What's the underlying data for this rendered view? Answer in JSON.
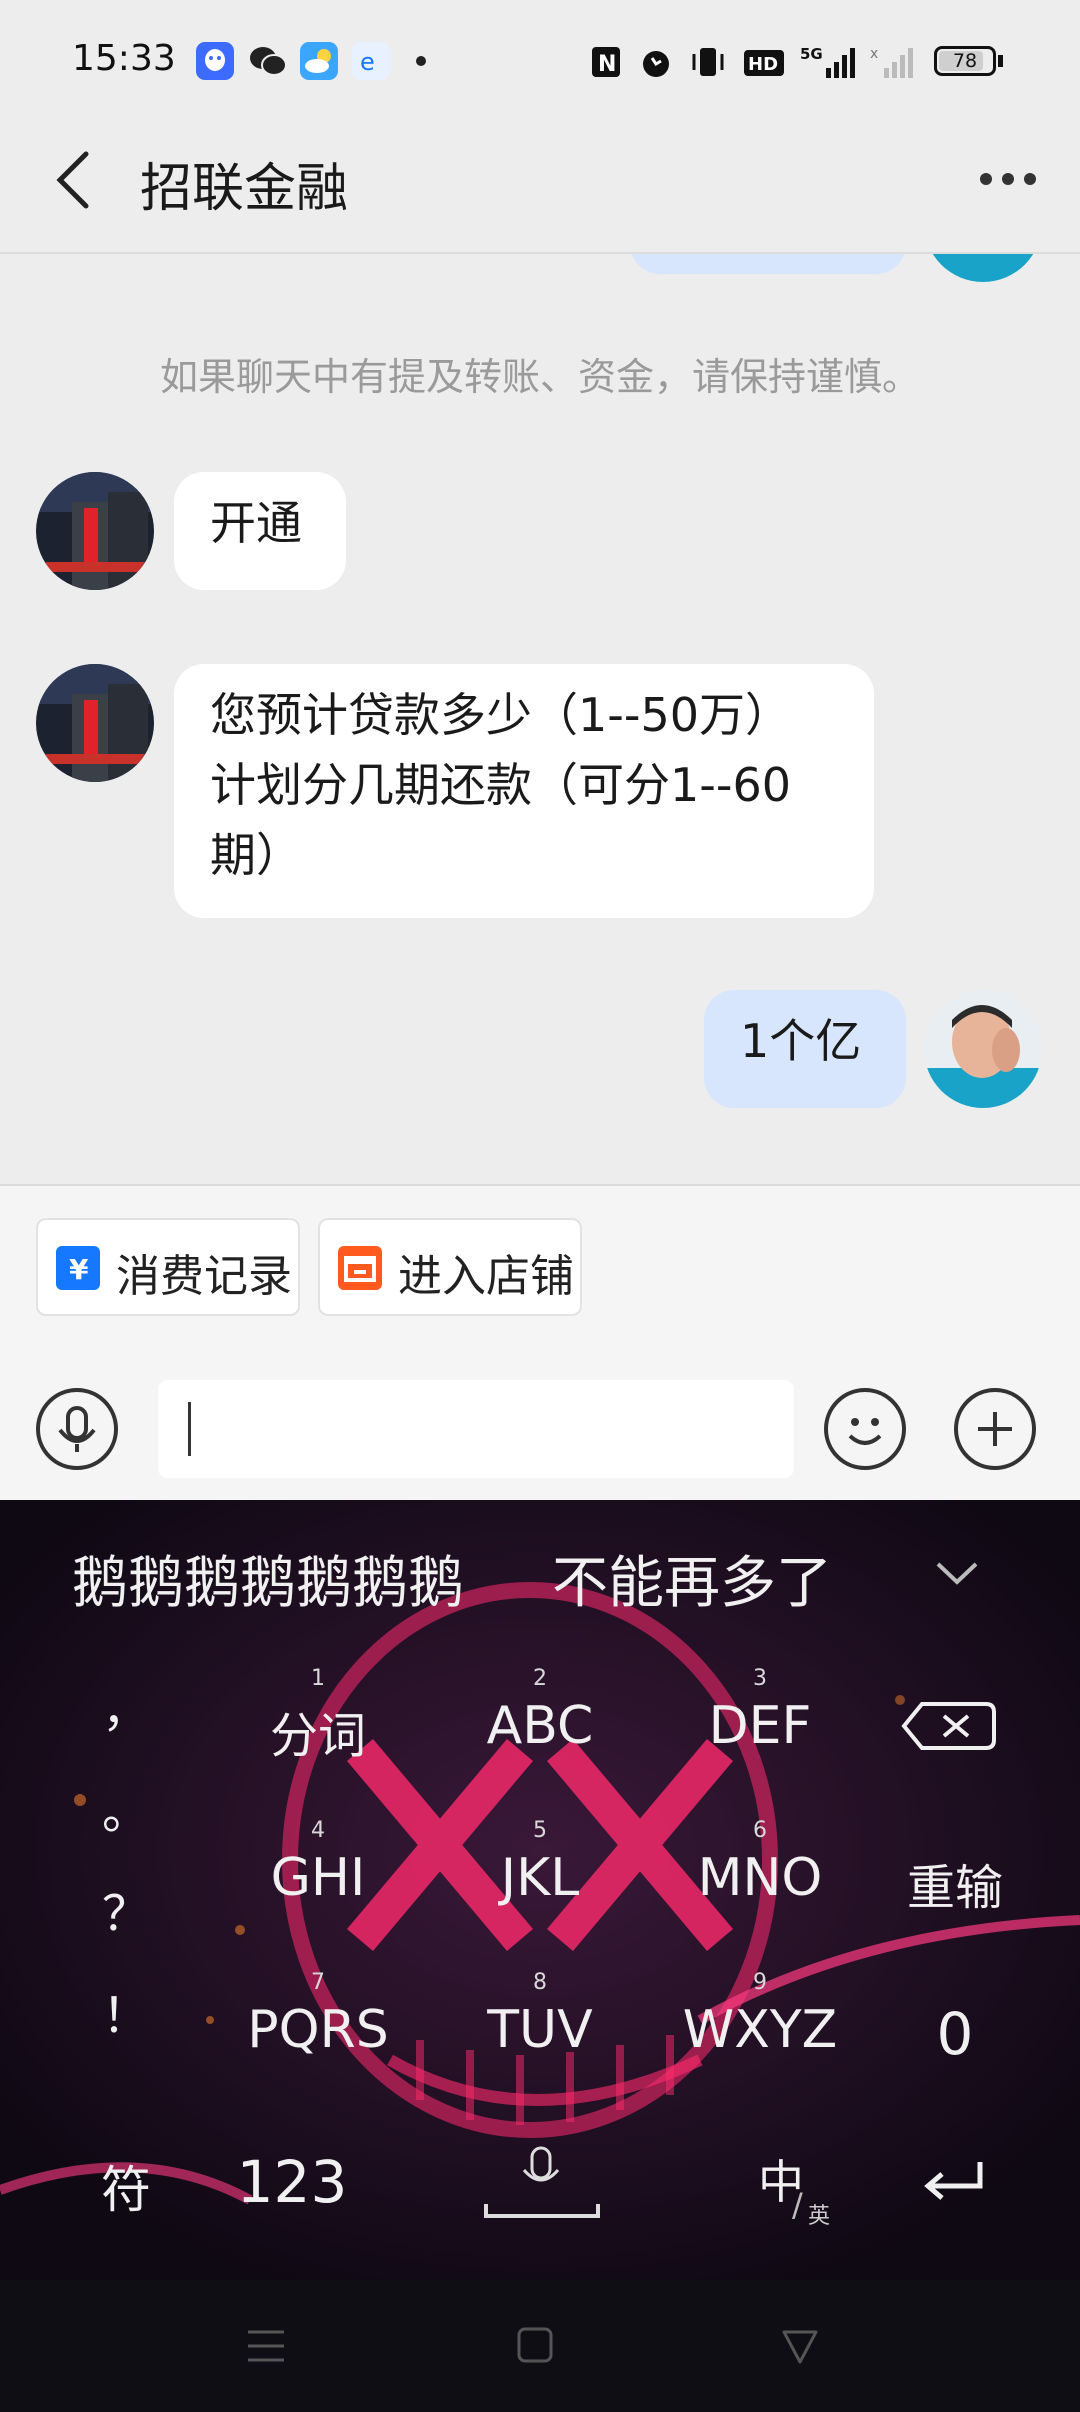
{
  "status_bar": {
    "time": "15:33",
    "battery": "78",
    "network": "5G",
    "hd_label": "HD"
  },
  "header": {
    "title": "招联金融"
  },
  "chat": {
    "notice": "如果聊天中有提及转账、资金，请保持谨慎。",
    "messages": [
      {
        "sender": "other",
        "text": "开通"
      },
      {
        "sender": "other",
        "text_lines": [
          "您预计贷款多少（1--50万）",
          "计划分几期还款（可分1--60",
          "期）"
        ]
      },
      {
        "sender": "me",
        "text": "1个亿"
      }
    ]
  },
  "quick_actions": [
    {
      "label": "消费记录",
      "icon": "yuan-receipt-icon"
    },
    {
      "label": "进入店铺",
      "icon": "store-icon"
    }
  ],
  "input": {
    "value": "",
    "placeholder": ""
  },
  "keyboard": {
    "candidates": [
      "鹅鹅鹅鹅鹅鹅鹅",
      "不能再多了"
    ],
    "side_keys": [
      "，",
      "。",
      "？",
      "！"
    ],
    "keys": [
      {
        "num": "1",
        "label": "分词"
      },
      {
        "num": "2",
        "label": "ABC"
      },
      {
        "num": "3",
        "label": "DEF"
      },
      {
        "num": "4",
        "label": "GHI"
      },
      {
        "num": "5",
        "label": "JKL"
      },
      {
        "num": "6",
        "label": "MNO"
      },
      {
        "num": "7",
        "label": "PQRS"
      },
      {
        "num": "8",
        "label": "TUV"
      },
      {
        "num": "9",
        "label": "WXYZ"
      }
    ],
    "reinput": "重输",
    "zero": "0",
    "symbol": "符",
    "num_switch": "123",
    "lang_main": "中",
    "lang_sub": "英"
  },
  "colors": {
    "page_bg": "#ededed",
    "bubble_other": "#ffffff",
    "bubble_me": "#d7e6fd",
    "keyboard_bg": "#150d1c",
    "accent_pink": "#ff2a6d",
    "chip_icon_blue": "#1677ff",
    "chip_icon_orange": "#ff5a1f"
  }
}
